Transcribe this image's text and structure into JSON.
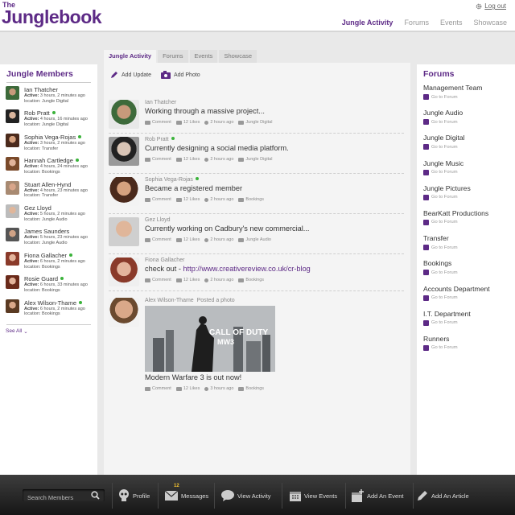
{
  "header": {
    "logo_small": "The",
    "logo_big": "Junglebook",
    "logout_label": "Log out",
    "nav": [
      "Jungle Activity",
      "Forums",
      "Events",
      "Showcase"
    ]
  },
  "tabs": [
    "Jungle Activity",
    "Forums",
    "Events",
    "Showcase"
  ],
  "left": {
    "title": "Jungle Members",
    "members": [
      {
        "name": "Ian Thatcher",
        "online": false,
        "active_label": "Active:",
        "active": "3 hours, 2 minutes ago",
        "location": "location: Jungle Digital"
      },
      {
        "name": "Rob Pratt",
        "online": true,
        "active_label": "Active:",
        "active": "4 hours, 16 minutes ago",
        "location": "location: Jungle Digital"
      },
      {
        "name": "Sophia Vega-Rojas",
        "online": true,
        "active_label": "Active:",
        "active": "3 hours, 2 minutes ago",
        "location": "location: Transfer"
      },
      {
        "name": "Hannah Cartledge",
        "online": true,
        "active_label": "Active:",
        "active": "4 hours, 24 minutes ago",
        "location": "location: Bookings"
      },
      {
        "name": "Stuart Allen-Hynd",
        "online": false,
        "active_label": "Active:",
        "active": "4 hours, 23 minutes ago",
        "location": "location: Transfer"
      },
      {
        "name": "Gez Lloyd",
        "online": false,
        "active_label": "Active:",
        "active": "5 hours, 2 minutes ago",
        "location": "location: Jungle Audio"
      },
      {
        "name": "James Saunders",
        "online": false,
        "active_label": "Active:",
        "active": "5 hours, 23 minutes ago",
        "location": "location: Jungle Audio"
      },
      {
        "name": "Fiona Gallacher",
        "online": true,
        "active_label": "Active:",
        "active": "6 hours, 2 minutes ago",
        "location": "location: Bookings"
      },
      {
        "name": "Rosie Guard",
        "online": true,
        "active_label": "Active:",
        "active": "6 hours, 33 minutes ago",
        "location": "location: Bookings"
      },
      {
        "name": "Alex Wilson-Thame",
        "online": true,
        "active_label": "Active:",
        "active": "6 hours, 2 minutes ago",
        "location": "location: Bookings"
      }
    ],
    "see_all": "See All"
  },
  "center": {
    "add_update": "Add Update",
    "add_photo": "Add Photo",
    "posts": [
      {
        "user": "Ian Thatcher",
        "online": false,
        "text": "Working through a massive project...",
        "link": "",
        "comment": "Comment",
        "likes": "12 Likes",
        "time": "2 hours ago",
        "tag": "Jungle Digital"
      },
      {
        "user": "Rob Pratt",
        "online": true,
        "text": "Currently designing a social media platform.",
        "link": "",
        "comment": "Comment",
        "likes": "12 Likes",
        "time": "2 hours ago",
        "tag": "Jungle Digital"
      },
      {
        "user": "Sophia Vega-Rojas",
        "online": true,
        "text": "Became a registered member",
        "link": "",
        "comment": "Comment",
        "likes": "12 Likes",
        "time": "2 hours ago",
        "tag": "Bookings"
      },
      {
        "user": "Gez Lloyd",
        "online": false,
        "text": "Currently working on Cadbury's new commercial...",
        "link": "",
        "comment": "Comment",
        "likes": "12 Likes",
        "time": "2 hours ago",
        "tag": "Jungle Audio"
      },
      {
        "user": "Fiona Gallacher",
        "online": false,
        "text": "check out - ",
        "link": "http://www.creativereview.co.uk/cr-blog",
        "comment": "Comment",
        "likes": "12 Likes",
        "time": "2 hours ago",
        "tag": "Bookings"
      }
    ],
    "photo_post": {
      "user": "Alex Wilson-Thame",
      "action": "Posted a photo",
      "photo_title_top": "CALL OF DUTY",
      "photo_title_bottom": "MW3",
      "caption": "Modern Warfare 3 is out now!",
      "comment": "Comment",
      "likes": "12 Likes",
      "time": "3 hours ago",
      "tag": "Bookings"
    }
  },
  "right": {
    "title": "Forums",
    "go_label": "Go to Forum",
    "forums": [
      "Management Team",
      "Jungle Audio",
      "Jungle Digital",
      "Jungle Music",
      "Jungle Pictures",
      "BearKatt Productions",
      "Transfer",
      "Bookings",
      "Accounts Department",
      "I.T. Department",
      "Runners"
    ]
  },
  "bottom": {
    "search_placeholder": "Search Members",
    "profile": "Profile",
    "messages": "Messages",
    "messages_count": "12",
    "view_activity": "View Activity",
    "view_events": "View Events",
    "add_event": "Add An Event",
    "add_article": "Add An Article"
  },
  "colors": {
    "brand": "#5d2a86",
    "online": "#3bb33b",
    "badge": "#f2c230"
  }
}
